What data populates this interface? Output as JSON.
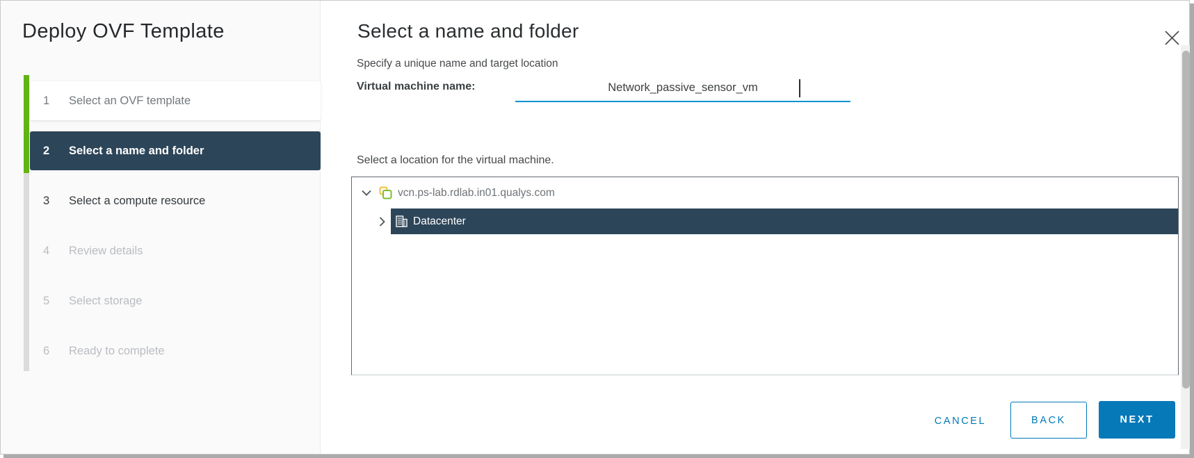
{
  "dialog": {
    "title": "Deploy OVF Template"
  },
  "steps": [
    {
      "num": "1",
      "label": "Select an OVF template"
    },
    {
      "num": "2",
      "label": "Select a name and folder"
    },
    {
      "num": "3",
      "label": "Select a compute resource"
    },
    {
      "num": "4",
      "label": "Review details"
    },
    {
      "num": "5",
      "label": "Select storage"
    },
    {
      "num": "6",
      "label": "Ready to complete"
    }
  ],
  "main": {
    "title": "Select a name and folder",
    "subtitle": "Specify a unique name and target location",
    "vm_name_label": "Virtual machine name:",
    "vm_name_value": "Network_passive_sensor_vm",
    "location_label": "Select a location for the virtual machine.",
    "tree": [
      {
        "label": "vcn.ps-lab.rdlab.in01.qualys.com",
        "expanded": true,
        "selected": false
      },
      {
        "label": "Datacenter",
        "expanded": false,
        "selected": true
      }
    ]
  },
  "footer": {
    "cancel_label": "CANCEL",
    "back_label": "BACK",
    "next_label": "NEXT"
  },
  "colors": {
    "accent_blue": "#0079b8",
    "underline_blue": "#0f92d0",
    "step_green": "#60b515",
    "selection_dark": "#2d4558",
    "vcenter_icon_green": "#7cc032",
    "vcenter_icon_yellow": "#f0c23c"
  }
}
